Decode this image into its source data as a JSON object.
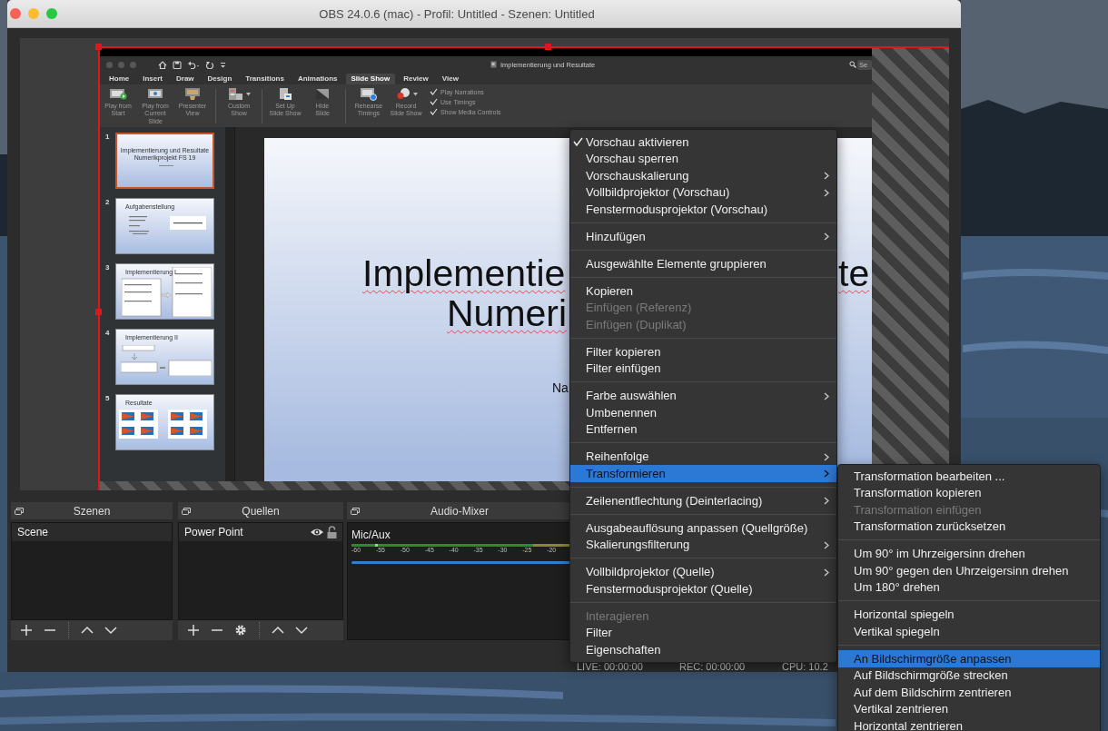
{
  "window": {
    "title": "OBS 24.0.6 (mac) - Profil: Untitled - Szenen: Untitled"
  },
  "preview": {
    "source": {
      "selected": true,
      "capture": {
        "document_title": "Implementierung und Resultate",
        "search_placeholder": "Se",
        "tabs": [
          {
            "label": "Home",
            "selected": false
          },
          {
            "label": "Insert",
            "selected": false
          },
          {
            "label": "Draw",
            "selected": false
          },
          {
            "label": "Design",
            "selected": false
          },
          {
            "label": "Transitions",
            "selected": false
          },
          {
            "label": "Animations",
            "selected": false
          },
          {
            "label": "Slide Show",
            "selected": true
          },
          {
            "label": "Review",
            "selected": false
          },
          {
            "label": "View",
            "selected": false
          }
        ],
        "ribbon_groups": [
          [
            {
              "label": "Play from\nStart",
              "dropdown": false
            },
            {
              "label": "Play from\nCurrent Slide",
              "dropdown": false
            },
            {
              "label": "Presenter\nView",
              "dropdown": false
            }
          ],
          [
            {
              "label": "Custom\nShow",
              "dropdown": true
            }
          ],
          [
            {
              "label": "Set Up\nSlide Show",
              "dropdown": false
            },
            {
              "label": "Hide\nSlide",
              "dropdown": false
            }
          ],
          [
            {
              "label": "Rehearse\nTimings",
              "dropdown": false
            },
            {
              "label": "Record\nSlide Show",
              "dropdown": true
            }
          ]
        ],
        "options": [
          {
            "label": "Play Narrations",
            "checked": true
          },
          {
            "label": "Use Timings",
            "checked": true
          },
          {
            "label": "Show Media Controls",
            "checked": true
          }
        ],
        "slides": [
          {
            "number": "1",
            "title": "Implementierung und Resultate\nNumerikprojekt FS 19",
            "selected": true
          },
          {
            "number": "2",
            "title": "Aufgabenstellung",
            "selected": false
          },
          {
            "number": "3",
            "title": "Implementierung I",
            "selected": false
          },
          {
            "number": "4",
            "title": "Implementierung II",
            "selected": false
          },
          {
            "number": "5",
            "title": "Resultate",
            "selected": false
          }
        ],
        "slide_texts": [
          {
            "text": "Implementie",
            "kind": "title"
          },
          {
            "text": "te",
            "kind": "title"
          },
          {
            "text": "Numeri",
            "kind": "title"
          },
          {
            "text": "Na",
            "kind": "subtitle"
          }
        ]
      }
    }
  },
  "docks": [
    {
      "kind": "scenes",
      "title": "Szenen",
      "items": [
        {
          "label": "Scene",
          "selected": true
        }
      ]
    },
    {
      "kind": "sources",
      "title": "Quellen",
      "items": [
        {
          "label": "Power Point",
          "selected": true,
          "visible": true,
          "locked": false
        }
      ]
    },
    {
      "kind": "mixer",
      "title": "Audio-Mixer",
      "channels": [
        {
          "name": "Mic/Aux",
          "meter_ticks": [
            "-60",
            "-55",
            "-50",
            "-45",
            "-40",
            "-35",
            "-30",
            "-25",
            "-20"
          ],
          "level": 1
        }
      ]
    }
  ],
  "status_bar": [
    "LIVE: 00:00:00",
    "REC: 00:00:00",
    "CPU: 10.2"
  ],
  "context_menu": {
    "sections": [
      [
        {
          "label": "Vorschau aktivieren",
          "checked": true,
          "disabled": false,
          "has_submenu": false,
          "selected": false
        },
        {
          "label": "Vorschau sperren",
          "checked": false,
          "disabled": false,
          "has_submenu": false,
          "selected": false
        },
        {
          "label": "Vorschauskalierung",
          "checked": false,
          "disabled": false,
          "has_submenu": true,
          "selected": false
        },
        {
          "label": "Vollbildprojektor (Vorschau)",
          "checked": false,
          "disabled": false,
          "has_submenu": true,
          "selected": false
        },
        {
          "label": "Fenstermodusprojektor (Vorschau)",
          "checked": false,
          "disabled": false,
          "has_submenu": false,
          "selected": false
        }
      ],
      [
        {
          "label": "Hinzufügen",
          "checked": false,
          "disabled": false,
          "has_submenu": true,
          "selected": false
        }
      ],
      [
        {
          "label": "Ausgewählte Elemente gruppieren",
          "checked": false,
          "disabled": false,
          "has_submenu": false,
          "selected": false
        }
      ],
      [
        {
          "label": "Kopieren",
          "checked": false,
          "disabled": false,
          "has_submenu": false,
          "selected": false
        },
        {
          "label": "Einfügen (Referenz)",
          "checked": false,
          "disabled": true,
          "has_submenu": false,
          "selected": false
        },
        {
          "label": "Einfügen (Duplikat)",
          "checked": false,
          "disabled": true,
          "has_submenu": false,
          "selected": false
        }
      ],
      [
        {
          "label": "Filter kopieren",
          "checked": false,
          "disabled": false,
          "has_submenu": false,
          "selected": false
        },
        {
          "label": "Filter einfügen",
          "checked": false,
          "disabled": false,
          "has_submenu": false,
          "selected": false
        }
      ],
      [
        {
          "label": "Farbe auswählen",
          "checked": false,
          "disabled": false,
          "has_submenu": true,
          "selected": false
        },
        {
          "label": "Umbenennen",
          "checked": false,
          "disabled": false,
          "has_submenu": false,
          "selected": false
        },
        {
          "label": "Entfernen",
          "checked": false,
          "disabled": false,
          "has_submenu": false,
          "selected": false
        }
      ],
      [
        {
          "label": "Reihenfolge",
          "checked": false,
          "disabled": false,
          "has_submenu": true,
          "selected": false
        },
        {
          "label": "Transformieren",
          "checked": false,
          "disabled": false,
          "has_submenu": true,
          "selected": true
        }
      ],
      [
        {
          "label": "Zeilenentflechtung (Deinterlacing)",
          "checked": false,
          "disabled": false,
          "has_submenu": true,
          "selected": false
        }
      ],
      [
        {
          "label": "Ausgabeauflösung anpassen (Quellgröße)",
          "checked": false,
          "disabled": false,
          "has_submenu": false,
          "selected": false
        },
        {
          "label": "Skalierungsfilterung",
          "checked": false,
          "disabled": false,
          "has_submenu": true,
          "selected": false
        }
      ],
      [
        {
          "label": "Vollbildprojektor (Quelle)",
          "checked": false,
          "disabled": false,
          "has_submenu": true,
          "selected": false
        },
        {
          "label": "Fenstermodusprojektor (Quelle)",
          "checked": false,
          "disabled": false,
          "has_submenu": false,
          "selected": false
        }
      ],
      [
        {
          "label": "Interagieren",
          "checked": false,
          "disabled": true,
          "has_submenu": false,
          "selected": false
        },
        {
          "label": "Filter",
          "checked": false,
          "disabled": false,
          "has_submenu": false,
          "selected": false
        },
        {
          "label": "Eigenschaften",
          "checked": false,
          "disabled": false,
          "has_submenu": false,
          "selected": false
        }
      ]
    ]
  },
  "submenu": {
    "sections": [
      [
        {
          "label": "Transformation bearbeiten ...",
          "disabled": false,
          "selected": false
        },
        {
          "label": "Transformation kopieren",
          "disabled": false,
          "selected": false
        },
        {
          "label": "Transformation einfügen",
          "disabled": true,
          "selected": false
        },
        {
          "label": "Transformation zurücksetzen",
          "disabled": false,
          "selected": false
        }
      ],
      [
        {
          "label": "Um 90° im Uhrzeigersinn drehen",
          "disabled": false,
          "selected": false
        },
        {
          "label": "Um 90° gegen den Uhrzeigersinn drehen",
          "disabled": false,
          "selected": false
        },
        {
          "label": "Um 180° drehen",
          "disabled": false,
          "selected": false
        }
      ],
      [
        {
          "label": "Horizontal spiegeln",
          "disabled": false,
          "selected": false
        },
        {
          "label": "Vertikal spiegeln",
          "disabled": false,
          "selected": false
        }
      ],
      [
        {
          "label": "An Bildschirmgröße anpassen",
          "disabled": false,
          "selected": true
        },
        {
          "label": "Auf Bildschirmgröße strecken",
          "disabled": false,
          "selected": false
        },
        {
          "label": "Auf dem Bildschirm zentrieren",
          "disabled": false,
          "selected": false
        },
        {
          "label": "Vertikal zentrieren",
          "disabled": false,
          "selected": false
        },
        {
          "label": "Horizontal zentrieren",
          "disabled": false,
          "selected": false
        }
      ]
    ]
  }
}
